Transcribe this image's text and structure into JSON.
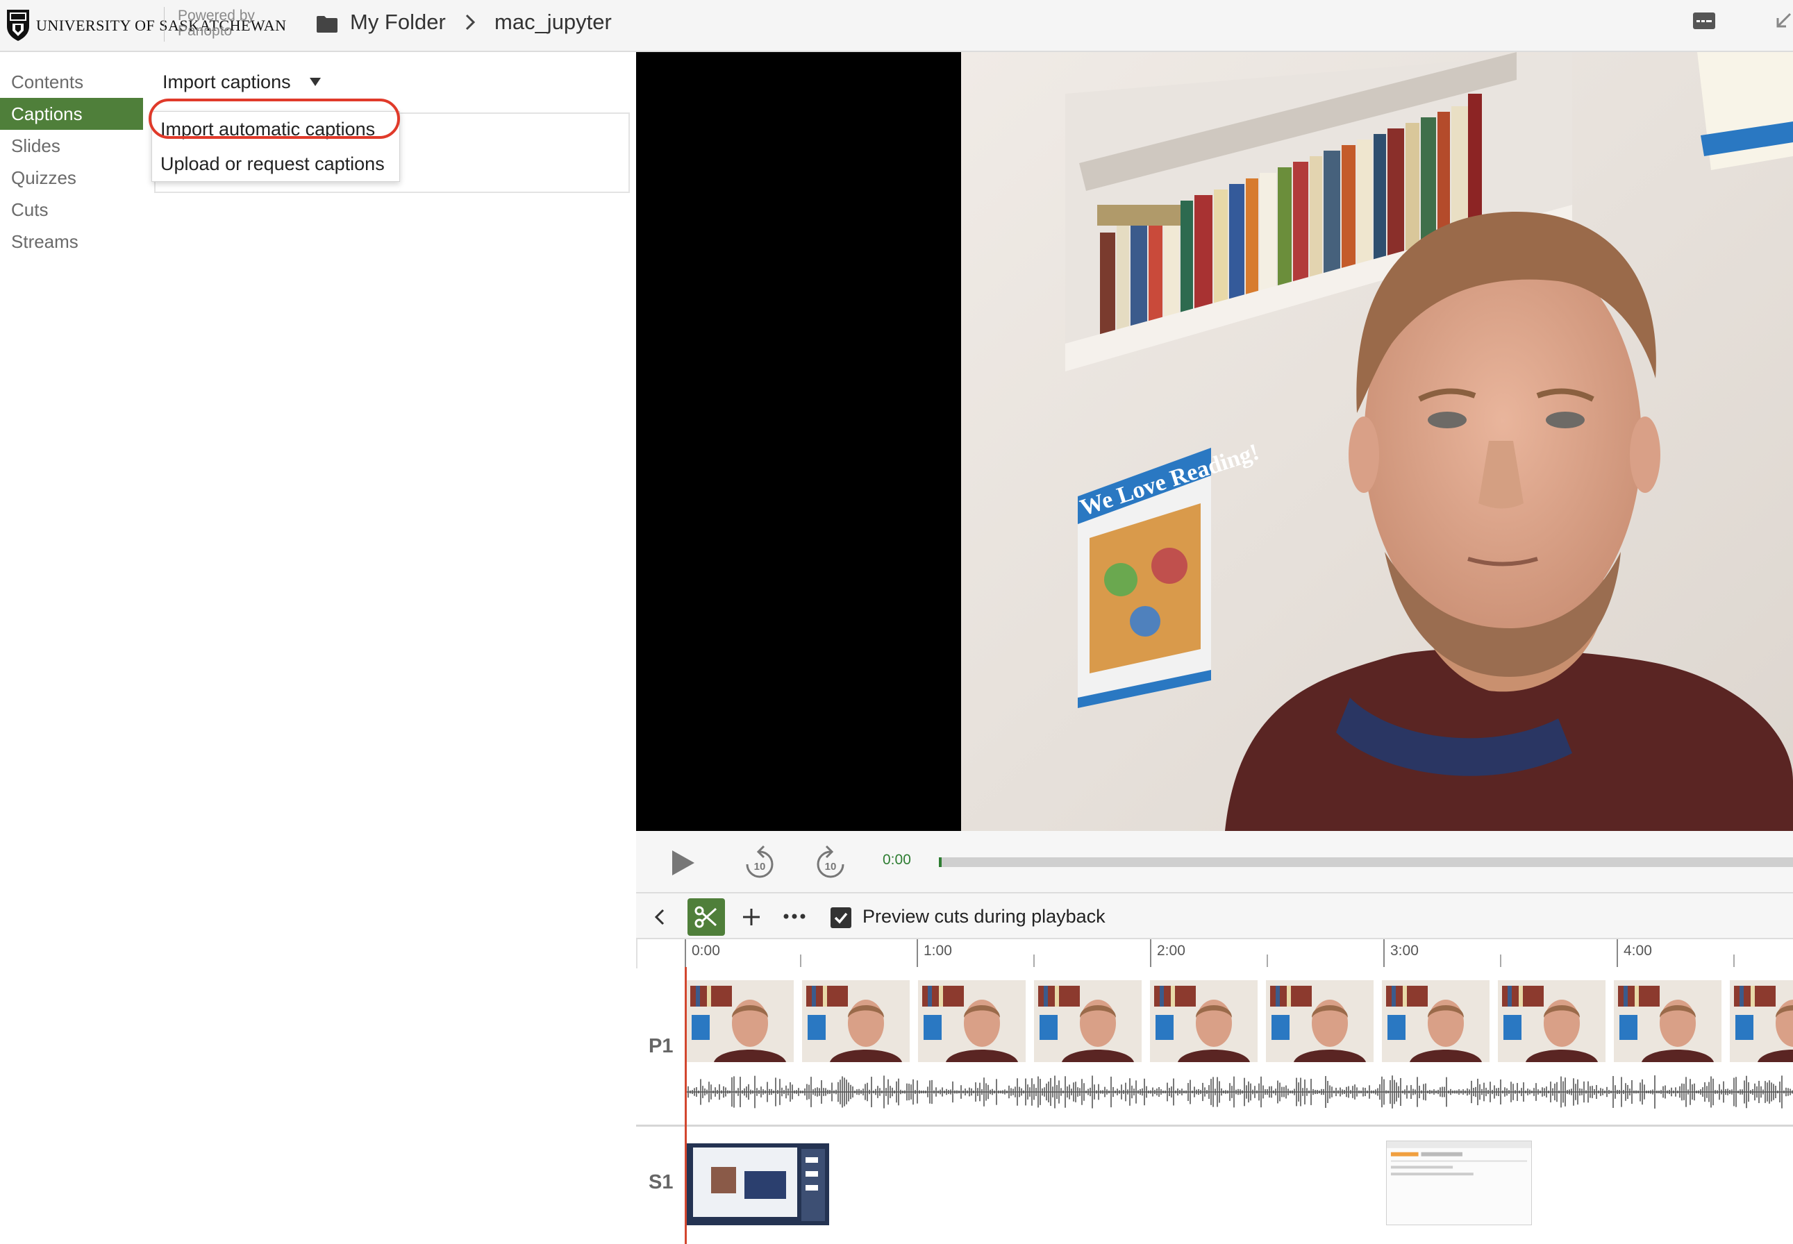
{
  "header": {
    "university": "UNIVERSITY OF SASKATCHEWAN",
    "powered_line1": "Powered by",
    "powered_line2": "Panopto",
    "breadcrumb_folder": "My Folder",
    "breadcrumb_session": "mac_jupyter"
  },
  "nav": {
    "items": [
      {
        "label": "Contents"
      },
      {
        "label": "Captions"
      },
      {
        "label": "Slides"
      },
      {
        "label": "Quizzes"
      },
      {
        "label": "Cuts"
      },
      {
        "label": "Streams"
      }
    ],
    "active": "Captions"
  },
  "captions": {
    "import_label": "Import captions",
    "dropdown": [
      {
        "label": "Import automatic captions"
      },
      {
        "label": "Upload or request captions"
      }
    ]
  },
  "player": {
    "time": "0:00",
    "progress": 0.0,
    "rewind_seconds": "10",
    "forward_seconds": "10",
    "poster_text": "We Love Reading!"
  },
  "toolbar": {
    "preview_label": "Preview cuts during playback",
    "preview_checked": true
  },
  "timeline": {
    "ticks": [
      "0:00",
      "1:00",
      "2:00",
      "3:00",
      "4:00"
    ],
    "tracks": [
      {
        "label": "P1"
      },
      {
        "label": "S1"
      }
    ]
  },
  "colors": {
    "accent_green": "#4f7f3a",
    "highlight_red": "#e03a2a",
    "playhead": "#d2472f"
  }
}
